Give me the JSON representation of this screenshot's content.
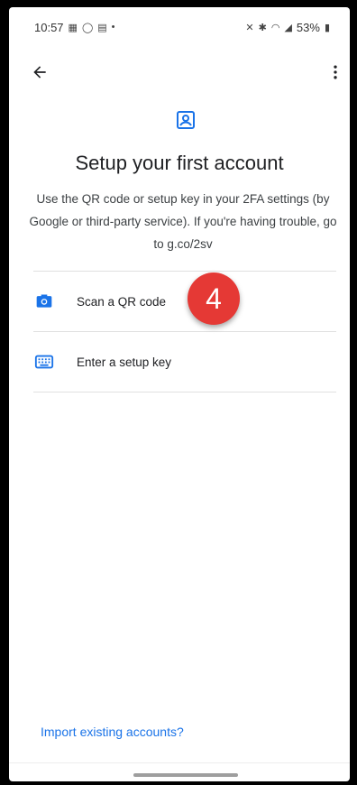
{
  "status_bar": {
    "time": "10:57",
    "battery": "53%",
    "icons_left": [
      "gallery-icon",
      "circle-icon",
      "message-icon",
      "dot-icon"
    ],
    "icons_right": [
      "mute-icon",
      "bluetooth-icon",
      "wifi-icon",
      "signal-icon",
      "battery-icon"
    ]
  },
  "header": {
    "back_icon": "arrow-left-icon",
    "menu_icon": "more-vert-icon"
  },
  "main": {
    "title": "Setup your first account",
    "description": "Use the QR code or setup key in your 2FA settings (by Google or third-party service). If you're having trouble, go to g.co/2sv",
    "options": [
      {
        "label": "Scan a QR code",
        "icon": "camera-icon"
      },
      {
        "label": "Enter a setup key",
        "icon": "keyboard-icon"
      }
    ],
    "step_badge": "4"
  },
  "footer": {
    "import_link": "Import existing accounts?"
  },
  "colors": {
    "accent": "#1a73e8",
    "badge": "#e53935"
  }
}
